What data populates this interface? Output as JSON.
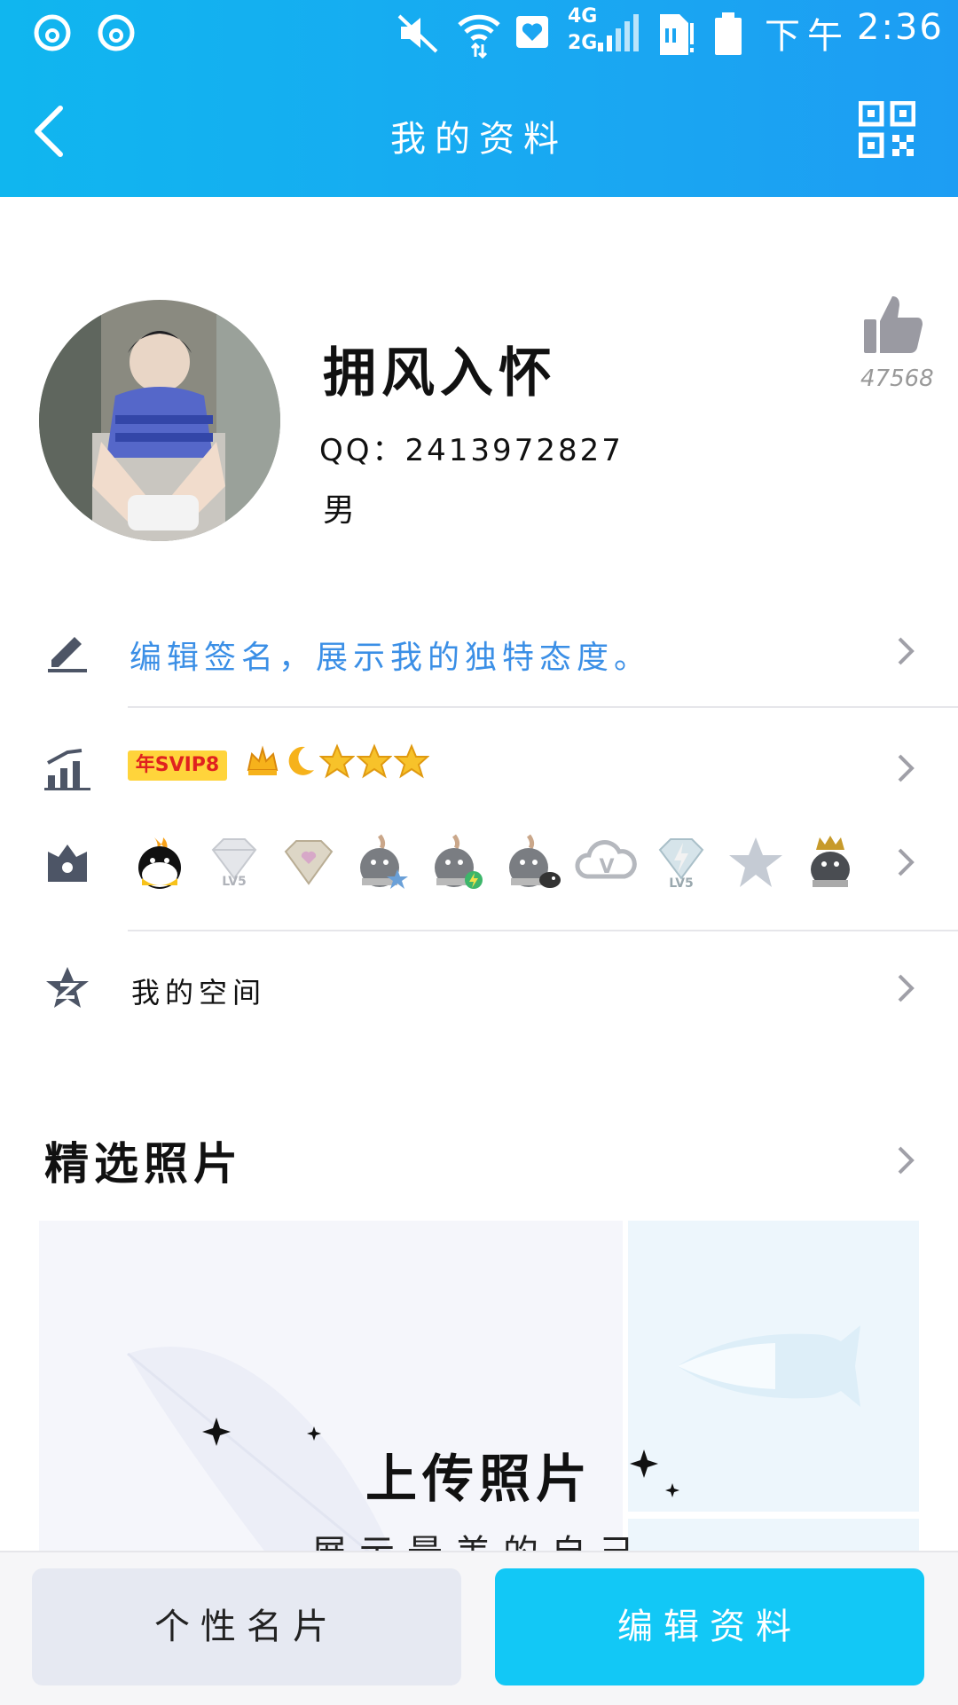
{
  "status_bar": {
    "ampm": "下午",
    "time": "2:36",
    "network": "4G",
    "network2": "2G"
  },
  "header": {
    "title": "我的资料"
  },
  "profile": {
    "nickname": "拥风入怀",
    "qq_label": "QQ：",
    "qq_number": "2413972827",
    "gender": "男",
    "likes": "47568"
  },
  "signature": {
    "placeholder": "编辑签名，展示我的独特态度。"
  },
  "vip": {
    "badge": "年SVIP8"
  },
  "badges": [
    "qq-penguin-flame",
    "diamond-lv5",
    "heart-diamond",
    "penguin-star",
    "penguin-bolt",
    "penguin-bird",
    "cloud-v",
    "diamond-lv5-grey",
    "grey-star",
    "penguin-crown"
  ],
  "badge_labels": {
    "lv5": "LV5",
    "v": "V"
  },
  "qzone": {
    "label": "我的空间"
  },
  "photos": {
    "title": "精选照片",
    "upload": "上传照片",
    "upload_sub": "展示最美的自己"
  },
  "buttons": {
    "card": "个性名片",
    "edit": "编辑资料"
  },
  "colors": {
    "header": "#19a8f2",
    "accent_link": "#3b8fe6",
    "edit_button": "#12c8f6",
    "vip_yellow": "#ffd43b",
    "vip_red": "#e0221f"
  }
}
